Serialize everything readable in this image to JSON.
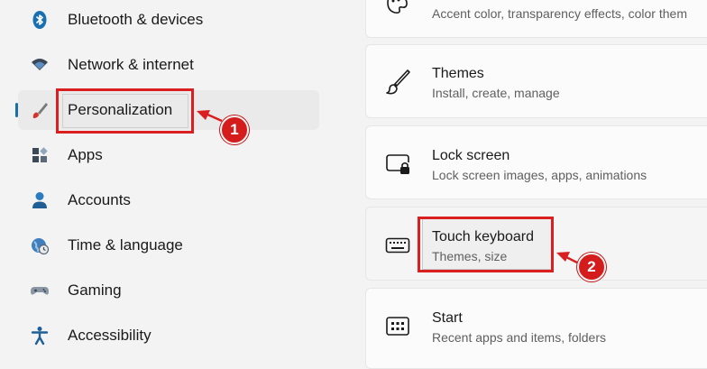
{
  "sidebar": {
    "items": [
      {
        "label": "Bluetooth & devices",
        "icon": "bluetooth-icon"
      },
      {
        "label": "Network & internet",
        "icon": "wifi-icon"
      },
      {
        "label": "Personalization",
        "icon": "paintbrush-icon",
        "selected": true
      },
      {
        "label": "Apps",
        "icon": "apps-icon"
      },
      {
        "label": "Accounts",
        "icon": "person-icon"
      },
      {
        "label": "Time & language",
        "icon": "globe-clock-icon"
      },
      {
        "label": "Gaming",
        "icon": "gamepad-icon"
      },
      {
        "label": "Accessibility",
        "icon": "accessibility-icon"
      }
    ]
  },
  "main": {
    "cards": [
      {
        "title": "",
        "subtitle": "Accent color, transparency effects, color them",
        "icon": "palette-icon"
      },
      {
        "title": "Themes",
        "subtitle": "Install, create, manage",
        "icon": "brush-icon"
      },
      {
        "title": "Lock screen",
        "subtitle": "Lock screen images, apps, animations",
        "icon": "lock-screen-icon"
      },
      {
        "title": "Touch keyboard",
        "subtitle": "Themes, size",
        "icon": "keyboard-icon"
      },
      {
        "title": "Start",
        "subtitle": "Recent apps and items, folders",
        "icon": "start-icon"
      }
    ]
  },
  "annotations": {
    "step1": "1",
    "step2": "2",
    "color": "#d91f1f"
  },
  "colors": {
    "accent": "#1c6ea4",
    "background": "#f3f3f3",
    "card": "#fbfbfb"
  }
}
